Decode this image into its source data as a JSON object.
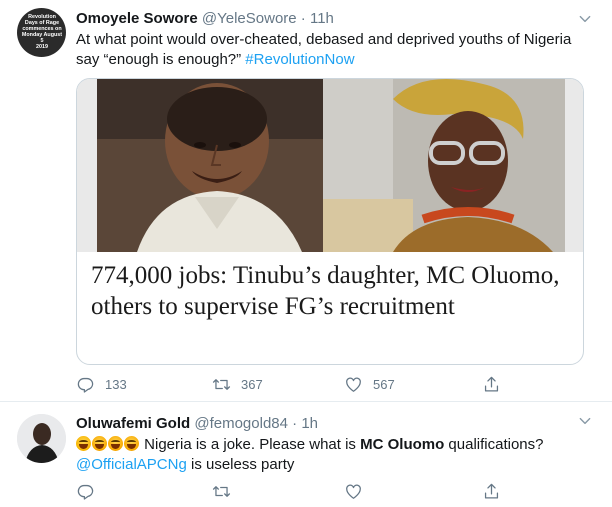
{
  "tweet": {
    "avatar_text": [
      "Revolution",
      "Days of Rage",
      "commences on",
      "Monday August 5",
      "2019"
    ],
    "name": "Omoyele Sowore",
    "handle": "@YeleSowore",
    "separator": "·",
    "time": "11h",
    "text_line1": "At what point would over-cheated, debased and deprived youths of Nigeria",
    "text_line2": "say “enough is enough?”",
    "hashtag": "#RevolutionNow",
    "card_title": "774,000 jobs: Tinubu’s daughter, MC Oluomo, others to supervise FG’s recruitment",
    "reply_count": "133",
    "retweet_count": "367",
    "like_count": "567"
  },
  "reply": {
    "name": "Oluwafemi Gold",
    "handle": "@femogold84",
    "separator": "·",
    "time": "1h",
    "text_a": " Nigeria is a joke. Please what is ",
    "text_bold": "MC Oluomo",
    "text_b": " qualifications?",
    "mention": "@OfficialAPCNg",
    "text_c": " is useless party"
  },
  "icons": {
    "reply": "reply-icon",
    "retweet": "retweet-icon",
    "like": "heart-icon",
    "share": "share-icon",
    "more": "chevron-down-icon"
  },
  "colors": {
    "link": "#1da1f2",
    "muted": "#657786",
    "border": "#e6ecf0"
  }
}
